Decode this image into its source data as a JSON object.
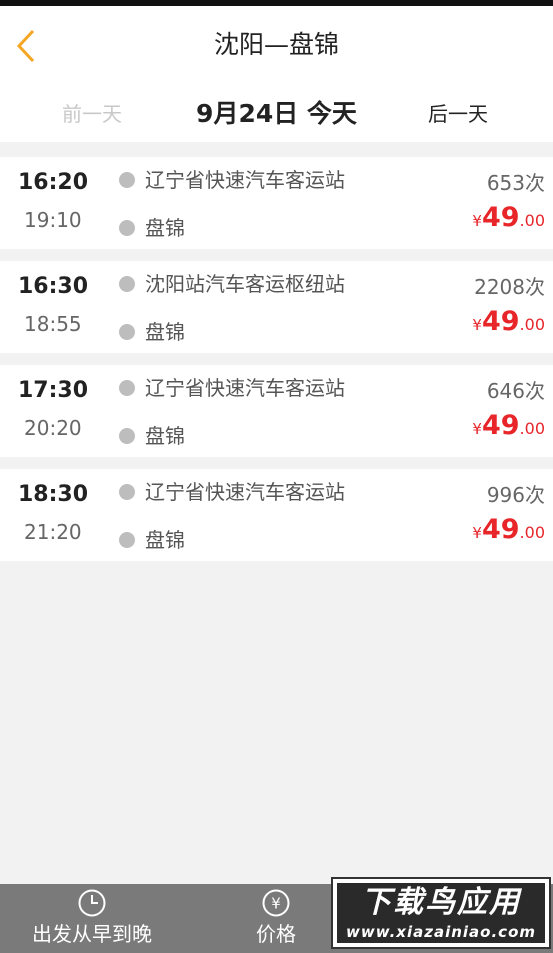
{
  "header": {
    "title": "沈阳—盘锦",
    "prev_day": "前一天",
    "current_date": "9月24日 今天",
    "next_day": "后一天"
  },
  "buses": [
    {
      "depart": "16:20",
      "arrive": "19:10",
      "station": "辽宁省快速汽车客运站",
      "destination": "盘锦",
      "trip": "653次",
      "price_symbol": "¥",
      "price_int": "49",
      "price_dec": ".00"
    },
    {
      "depart": "16:30",
      "arrive": "18:55",
      "station": "沈阳站汽车客运枢纽站",
      "destination": "盘锦",
      "trip": "2208次",
      "price_symbol": "¥",
      "price_int": "49",
      "price_dec": ".00"
    },
    {
      "depart": "17:30",
      "arrive": "20:20",
      "station": "辽宁省快速汽车客运站",
      "destination": "盘锦",
      "trip": "646次",
      "price_symbol": "¥",
      "price_int": "49",
      "price_dec": ".00"
    },
    {
      "depart": "18:30",
      "arrive": "21:20",
      "station": "辽宁省快速汽车客运站",
      "destination": "盘锦",
      "trip": "996次",
      "price_symbol": "¥",
      "price_int": "49",
      "price_dec": ".00"
    }
  ],
  "bottom_bar": {
    "sort_label": "出发从早到晚",
    "price_label": "价格",
    "price_icon_glyph": "¥"
  },
  "watermark": {
    "main": "下载鸟应用",
    "url": "www.xiazainiao.com"
  },
  "colors": {
    "accent": "#f5a623",
    "price": "#e8262a",
    "bottom_bar": "#7a7a7a"
  }
}
